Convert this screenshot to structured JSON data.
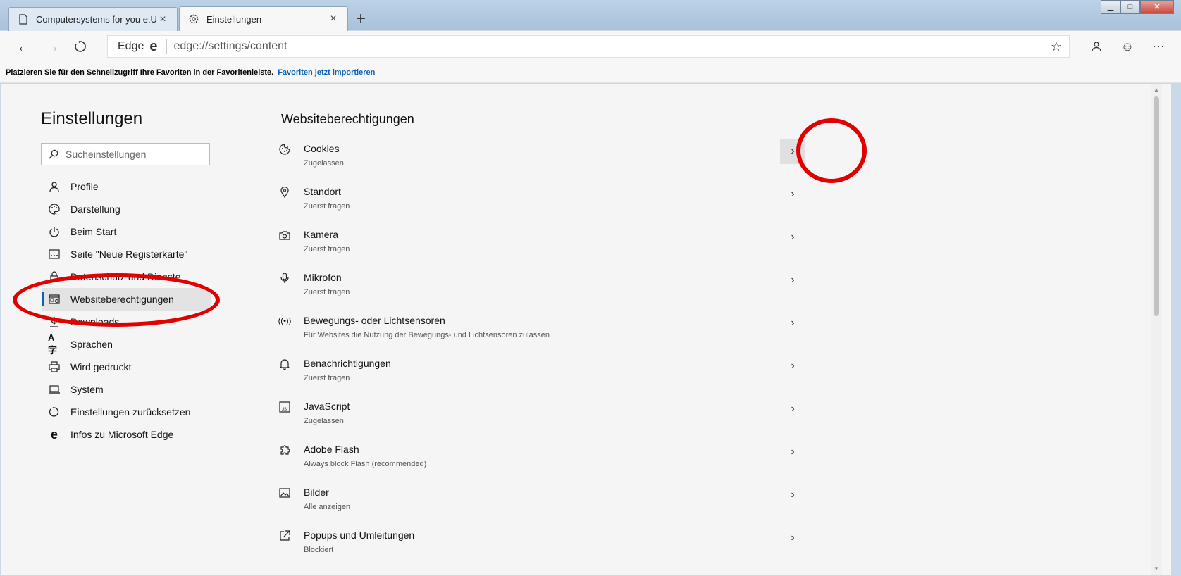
{
  "tabs": [
    {
      "label": "Computersystems for you e.U.",
      "icon": "document-icon"
    },
    {
      "label": "Einstellungen",
      "icon": "gear-icon"
    }
  ],
  "window_controls": {
    "minimize": "▁",
    "maximize": "□",
    "close": "✕"
  },
  "toolbar": {
    "address_prefix": "Edge",
    "url": "edge://settings/content"
  },
  "favorites_bar": {
    "text": "Platzieren Sie für den Schnellzugriff Ihre Favoriten in der Favoritenleiste.",
    "link": "Favoriten jetzt importieren"
  },
  "sidebar": {
    "title": "Einstellungen",
    "search_placeholder": "Sucheinstellungen",
    "items": [
      {
        "label": "Profile",
        "icon": "person-icon"
      },
      {
        "label": "Darstellung",
        "icon": "palette-icon"
      },
      {
        "label": "Beim Start",
        "icon": "power-icon"
      },
      {
        "label": "Seite \"Neue Registerkarte\"",
        "icon": "newtab-icon"
      },
      {
        "label": "Datenschutz und Dienste",
        "icon": "lock-icon"
      },
      {
        "label": "Websiteberechtigungen",
        "icon": "site-permissions-icon"
      },
      {
        "label": "Downloads",
        "icon": "download-icon"
      },
      {
        "label": "Sprachen",
        "icon": "language-icon"
      },
      {
        "label": "Wird gedruckt",
        "icon": "printer-icon"
      },
      {
        "label": "System",
        "icon": "laptop-icon"
      },
      {
        "label": "Einstellungen zurücksetzen",
        "icon": "reset-icon"
      },
      {
        "label": "Infos zu Microsoft Edge",
        "icon": "edge-logo-icon"
      }
    ],
    "selected_index": 5
  },
  "main": {
    "title": "Websiteberechtigungen",
    "permissions": [
      {
        "label": "Cookies",
        "sub": "Zugelassen",
        "icon": "cookie-icon"
      },
      {
        "label": "Standort",
        "sub": "Zuerst fragen",
        "icon": "location-icon"
      },
      {
        "label": "Kamera",
        "sub": "Zuerst fragen",
        "icon": "camera-icon"
      },
      {
        "label": "Mikrofon",
        "sub": "Zuerst fragen",
        "icon": "microphone-icon"
      },
      {
        "label": "Bewegungs- oder Lichtsensoren",
        "sub": "Für Websites die Nutzung der Bewegungs- und Lichtsensoren zulassen",
        "icon": "sensor-icon"
      },
      {
        "label": "Benachrichtigungen",
        "sub": "Zuerst fragen",
        "icon": "bell-icon"
      },
      {
        "label": "JavaScript",
        "sub": "Zugelassen",
        "icon": "javascript-icon"
      },
      {
        "label": "Adobe Flash",
        "sub": "Always block Flash (recommended)",
        "icon": "puzzle-icon"
      },
      {
        "label": "Bilder",
        "sub": "Alle anzeigen",
        "icon": "image-icon"
      },
      {
        "label": "Popups und Umleitungen",
        "sub": "Blockiert",
        "icon": "popup-icon"
      }
    ]
  },
  "colors": {
    "accent": "#0a62b8",
    "annotation": "#e10000"
  }
}
